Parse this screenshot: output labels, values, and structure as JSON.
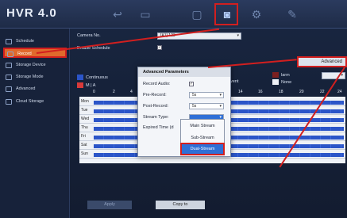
{
  "app": {
    "title": "HVR 4.0"
  },
  "toolbar": {
    "icons": [
      "back-icon",
      "playback-icon",
      "folder-icon",
      "storage-icon",
      "settings-icon",
      "edit-icon"
    ],
    "active": "storage-icon"
  },
  "sidebar": {
    "items": [
      {
        "label": "Schedule",
        "icon": "calendar-icon"
      },
      {
        "label": "Record",
        "icon": "record-icon",
        "selected": true
      },
      {
        "label": "Storage Device",
        "icon": "device-icon"
      },
      {
        "label": "Storage Mode",
        "icon": "mode-icon"
      },
      {
        "label": "Advanced",
        "icon": "advanced-icon"
      },
      {
        "label": "Cloud Storage",
        "icon": "cloud-icon"
      }
    ]
  },
  "main": {
    "camera_label": "Camera No.",
    "camera_value": "[A1] 123",
    "enable_label": "Enable Schedule",
    "advanced_button": "Advanced",
    "legend": {
      "continuous": "Continuous",
      "motion_alarm": "M | A",
      "event": "vent",
      "alarm": "larm",
      "none": "None"
    },
    "hours": [
      "0",
      "2",
      "4",
      "14",
      "16",
      "18",
      "20",
      "22",
      "24"
    ],
    "days": [
      "Mon",
      "Tue",
      "Wed",
      "Thu",
      "Fri",
      "Sat",
      "Sun"
    ],
    "apply_label": "Apply",
    "copy_label": "Copy to"
  },
  "dialog": {
    "title": "Advanced Parameters",
    "record_audio_label": "Record Audio:",
    "pre_record_label": "Pre-Record:",
    "pre_record_value": "5s",
    "post_record_label": "Post-Record:",
    "post_record_value": "5s",
    "stream_type_label": "Stream Type:",
    "expired_label": "Expired Time (d",
    "stream_options": [
      "Main Stream",
      "Sub-Stream",
      "Dual-Stream"
    ]
  },
  "colors": {
    "accent": "#d21f1f",
    "selected": "#e06a2c",
    "schedule": "#2b55c8"
  }
}
